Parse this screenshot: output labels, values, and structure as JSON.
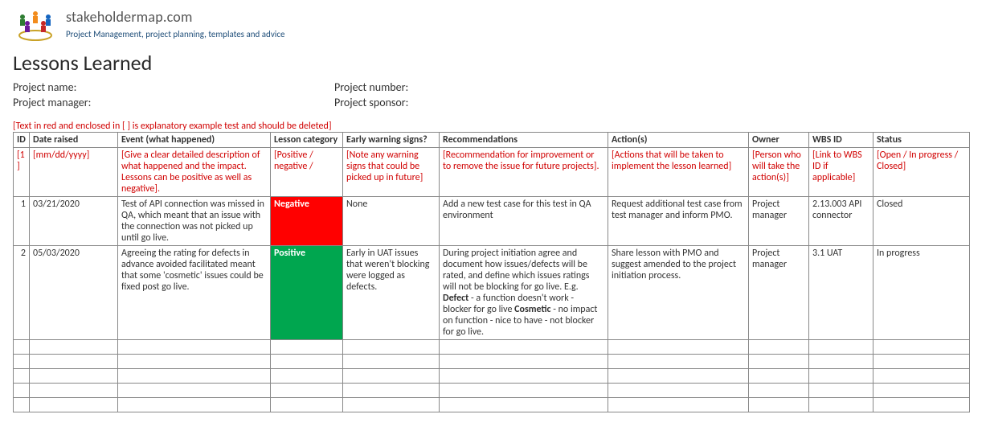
{
  "brand": {
    "name": "stakeholdermap.com",
    "tagline": "Project Management, project planning, templates and advice"
  },
  "title": "Lessons Learned",
  "meta": {
    "project_name_label": "Project name:",
    "project_number_label": "Project number:",
    "project_manager_label": "Project manager:",
    "project_sponsor_label": "Project sponsor:"
  },
  "explanatory_note": "[Text in red and enclosed in [ ] is explanatory example test and should be deleted]",
  "headers": {
    "id": "ID",
    "date_raised": "Date raised",
    "event": "Event (what happened)",
    "category": "Lesson category",
    "warning": "Early warning signs?",
    "recommendations": "Recommendations",
    "actions": "Action(s)",
    "owner": "Owner",
    "wbs": "WBS ID",
    "status": "Status"
  },
  "example_row": {
    "id": "[1]",
    "date_raised": "[mm/dd/yyyy]",
    "event": "[Give a clear detailed description of what happened and the impact. Lessons can be positive as well as negative].",
    "category": "[Positive / negative /",
    "warning": "[Note any warning signs that could be picked up in future]",
    "recommendations": "[Recommendation for improvement or to remove the issue for future projects].",
    "actions": "[Actions that will be taken to implement the lesson learned]",
    "owner": "[Person who will take the action(s)]",
    "wbs": "[Link to WBS ID if applicable]",
    "status": "[Open / In progress / Closed]"
  },
  "rows": [
    {
      "id": "1",
      "date_raised": "03/21/2020",
      "event": "Test of API connection was missed in QA, which meant that an issue with the connection was not picked up until go live.",
      "category": "Negative",
      "category_class": "neg",
      "warning": "None",
      "recommendations": "Add a new test case for this test in QA environment",
      "actions": "Request additional test case from test manager and inform PMO.",
      "owner": "Project manager",
      "wbs": "2.13.003 API connector",
      "status": "Closed"
    },
    {
      "id": "2",
      "date_raised": "05/03/2020",
      "event": "Agreeing the rating for defects in advance avoided facilitated meant that some 'cosmetic' issues could be fixed post go live.",
      "category": "Positive",
      "category_class": "pos",
      "warning": "Early in UAT issues that weren't blocking were logged as defects.",
      "recommendations_html": "During project initiation agree and document how issues/defects will be rated, and define which issues ratings will not be blocking for go live. E.g. <b>Defect</b> - a function doesn't work - blocker for go live <b>Cosmetic</b> - no impact on function - nice to have - not blocker for go live.",
      "actions": "Share lesson with PMO and suggest amended to the project initiation process.",
      "owner": "Project manager",
      "wbs": "3.1 UAT",
      "status": "In progress"
    }
  ],
  "empty_rows": 5
}
